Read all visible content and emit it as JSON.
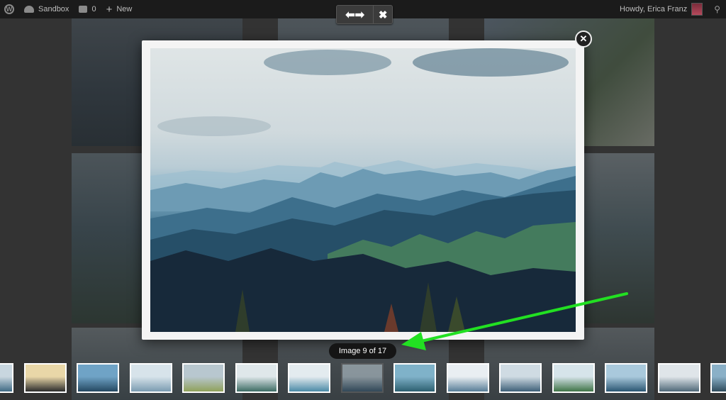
{
  "adminbar": {
    "site_name": "Sandbox",
    "comments_count": "0",
    "new_label": "New",
    "greeting": "Howdy, Erica Franz"
  },
  "lightbox": {
    "counter": "Image 9 of 17",
    "current_index": 9,
    "total": 17
  },
  "icons": {
    "wordpress": "wordpress-icon",
    "dashboard": "gauge-icon",
    "comments": "comment-bubble-icon",
    "new": "plus-icon",
    "search": "search-icon",
    "prev": "arrow-left-icon",
    "next": "arrow-right-icon",
    "close": "close-icon"
  },
  "colors": {
    "adminbar": "#1b1b1b",
    "annotation_arrow": "#22e022",
    "counter_bg": "#151515"
  },
  "thumbnails": [
    {
      "colors": [
        "#c8d6df",
        "#3f6a84"
      ]
    },
    {
      "colors": [
        "#e9d7a8",
        "#2b2b2b"
      ]
    },
    {
      "colors": [
        "#6fa3c6",
        "#244861"
      ]
    },
    {
      "colors": [
        "#d7e3ea",
        "#7a9bb0"
      ]
    },
    {
      "colors": [
        "#b8c7cf",
        "#8fa15a"
      ]
    },
    {
      "colors": [
        "#dfe7ea",
        "#3c6b63"
      ]
    },
    {
      "colors": [
        "#e3ebef",
        "#4a8aa6"
      ]
    },
    {
      "colors": [
        "#b9c9d2",
        "#2c4d66"
      ]
    },
    {
      "colors": [
        "#7fb2c9",
        "#2c5f70"
      ]
    },
    {
      "colors": [
        "#e9eef2",
        "#577d97"
      ]
    },
    {
      "colors": [
        "#cfdbe3",
        "#3d5f78"
      ]
    },
    {
      "colors": [
        "#d6e4ea",
        "#3f7447"
      ]
    },
    {
      "colors": [
        "#a9c9dc",
        "#2a5672"
      ]
    },
    {
      "colors": [
        "#dfe5e9",
        "#4f6878"
      ]
    },
    {
      "colors": [
        "#8ab0c7",
        "#2e4b5c"
      ]
    }
  ]
}
